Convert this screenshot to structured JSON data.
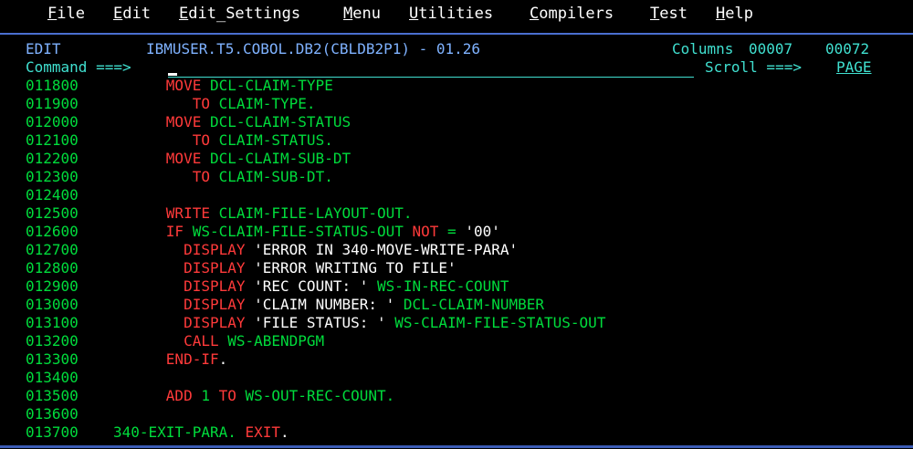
{
  "menubar": [
    {
      "accel": "F",
      "rest": "ile"
    },
    {
      "accel": "E",
      "rest": "dit"
    },
    {
      "accel": "E",
      "rest": "dit_Settings"
    },
    {
      "accel": "M",
      "rest": "enu"
    },
    {
      "accel": "U",
      "rest": "tilities"
    },
    {
      "accel": "C",
      "rest": "ompilers"
    },
    {
      "accel": "T",
      "rest": "est"
    },
    {
      "accel": "H",
      "rest": "elp"
    }
  ],
  "header": {
    "mode": "EDIT",
    "dataset": "IBMUSER.T5.COBOL.DB2(CBLDB2P1) - 01.26",
    "columns_label": "Columns",
    "col_start": "00007",
    "col_end": "00072",
    "command_label": "Command ===>",
    "command_value": "",
    "scroll_label": "Scroll ===>",
    "scroll_value": "PAGE"
  },
  "colors": {
    "line_number": "#00dc3c",
    "keyword": "#ff3a3a",
    "identifier": "#00dc3c",
    "literal": "#ffffff",
    "header": "#7fb2ff",
    "header_accent": "#40e0d0"
  },
  "lines": [
    {
      "num": "011800",
      "tokens": [
        {
          "t": "      "
        },
        {
          "t": "MOVE",
          "c": "red"
        },
        {
          "t": " DCL-CLAIM-TYPE",
          "c": "green"
        }
      ]
    },
    {
      "num": "011900",
      "tokens": [
        {
          "t": "         "
        },
        {
          "t": "TO",
          "c": "red"
        },
        {
          "t": " CLAIM-TYPE.",
          "c": "green"
        }
      ]
    },
    {
      "num": "012000",
      "tokens": [
        {
          "t": "      "
        },
        {
          "t": "MOVE",
          "c": "red"
        },
        {
          "t": " DCL-CLAIM-STATUS",
          "c": "green"
        }
      ]
    },
    {
      "num": "012100",
      "tokens": [
        {
          "t": "         "
        },
        {
          "t": "TO",
          "c": "red"
        },
        {
          "t": " CLAIM-STATUS.",
          "c": "green"
        }
      ]
    },
    {
      "num": "012200",
      "tokens": [
        {
          "t": "      "
        },
        {
          "t": "MOVE",
          "c": "red"
        },
        {
          "t": " DCL-CLAIM-SUB-DT",
          "c": "green"
        }
      ]
    },
    {
      "num": "012300",
      "tokens": [
        {
          "t": "         "
        },
        {
          "t": "TO",
          "c": "red"
        },
        {
          "t": " CLAIM-SUB-DT.",
          "c": "green"
        }
      ]
    },
    {
      "num": "012400",
      "tokens": []
    },
    {
      "num": "012500",
      "tokens": [
        {
          "t": "      "
        },
        {
          "t": "WRITE",
          "c": "red"
        },
        {
          "t": " CLAIM-FILE-LAYOUT-OUT.",
          "c": "green"
        }
      ]
    },
    {
      "num": "012600",
      "tokens": [
        {
          "t": "      "
        },
        {
          "t": "IF",
          "c": "red"
        },
        {
          "t": " WS-CLAIM-FILE-STATUS-OUT ",
          "c": "green"
        },
        {
          "t": "NOT",
          "c": "red"
        },
        {
          "t": " = ",
          "c": "green"
        },
        {
          "t": "'00'",
          "c": "white"
        }
      ]
    },
    {
      "num": "012700",
      "tokens": [
        {
          "t": "        "
        },
        {
          "t": "DISPLAY",
          "c": "red"
        },
        {
          "t": " 'ERROR IN 340-MOVE-WRITE-PARA'",
          "c": "white"
        }
      ]
    },
    {
      "num": "012800",
      "tokens": [
        {
          "t": "        "
        },
        {
          "t": "DISPLAY",
          "c": "red"
        },
        {
          "t": " 'ERROR WRITING TO FILE'",
          "c": "white"
        }
      ]
    },
    {
      "num": "012900",
      "tokens": [
        {
          "t": "        "
        },
        {
          "t": "DISPLAY",
          "c": "red"
        },
        {
          "t": " 'REC COUNT: '",
          "c": "white"
        },
        {
          "t": " WS-IN-REC-COUNT",
          "c": "green"
        }
      ]
    },
    {
      "num": "013000",
      "tokens": [
        {
          "t": "        "
        },
        {
          "t": "DISPLAY",
          "c": "red"
        },
        {
          "t": " 'CLAIM NUMBER: '",
          "c": "white"
        },
        {
          "t": " DCL-CLAIM-NUMBER",
          "c": "green"
        }
      ]
    },
    {
      "num": "013100",
      "tokens": [
        {
          "t": "        "
        },
        {
          "t": "DISPLAY",
          "c": "red"
        },
        {
          "t": " 'FILE STATUS: '",
          "c": "white"
        },
        {
          "t": " WS-CLAIM-FILE-STATUS-OUT",
          "c": "green"
        }
      ]
    },
    {
      "num": "013200",
      "tokens": [
        {
          "t": "        "
        },
        {
          "t": "CALL",
          "c": "red"
        },
        {
          "t": " WS-ABENDPGM",
          "c": "green"
        }
      ]
    },
    {
      "num": "013300",
      "tokens": [
        {
          "t": "      "
        },
        {
          "t": "END-IF",
          "c": "red"
        },
        {
          "t": ".",
          "c": "white"
        }
      ]
    },
    {
      "num": "013400",
      "tokens": []
    },
    {
      "num": "013500",
      "tokens": [
        {
          "t": "      "
        },
        {
          "t": "ADD",
          "c": "red"
        },
        {
          "t": " 1 ",
          "c": "green"
        },
        {
          "t": "TO",
          "c": "red"
        },
        {
          "t": " WS-OUT-REC-COUNT.",
          "c": "green"
        }
      ]
    },
    {
      "num": "013600",
      "tokens": []
    },
    {
      "num": "013700",
      "tokens": [
        {
          "t": "340-EXIT-PARA. ",
          "c": "green"
        },
        {
          "t": "EXIT",
          "c": "red"
        },
        {
          "t": ".",
          "c": "white"
        }
      ]
    }
  ]
}
